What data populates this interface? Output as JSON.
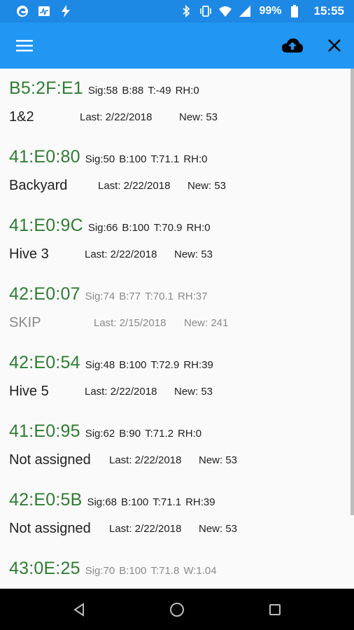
{
  "status_bar": {
    "left_icons": [
      "edge-browser-icon",
      "activity-monitor-icon",
      "flash-icon"
    ],
    "right_icons": [
      "bluetooth-icon",
      "vibrate-icon",
      "wifi-icon",
      "signal-icon",
      "battery-icon"
    ],
    "battery_percent": "99%",
    "time": "15:55"
  },
  "app_bar": {
    "menu_icon": "hamburger-menu-icon",
    "upload_icon": "cloud-upload-icon",
    "close_icon": "close-icon",
    "color": "#2196f3"
  },
  "colors": {
    "mac_green": "#2e7d32",
    "primary_text": "#212121",
    "dim_text": "#8a8a8a"
  },
  "devices": [
    {
      "mac": "B5:2F:E1",
      "sig": "Sig:58",
      "b": "B:88",
      "t": "T:-49",
      "extra": "RH:0",
      "name": "1&2",
      "last": "Last: 2/22/2018",
      "new": "New: 53",
      "dim": false
    },
    {
      "mac": "41:E0:80",
      "sig": "Sig:50",
      "b": "B:100",
      "t": "T:71.1",
      "extra": "RH:0",
      "name": "Backyard",
      "last": "Last: 2/22/2018",
      "new": "New: 53",
      "dim": false
    },
    {
      "mac": "41:E0:9C",
      "sig": "Sig:66",
      "b": "B:100",
      "t": "T:70.9",
      "extra": "RH:0",
      "name": "Hive 3",
      "last": "Last: 2/22/2018",
      "new": "New: 53",
      "dim": false
    },
    {
      "mac": "42:E0:07",
      "sig": "Sig:74",
      "b": "B:77",
      "t": "T:70.1",
      "extra": "RH:37",
      "name": "SKIP",
      "last": "Last: 2/15/2018",
      "new": "New: 241",
      "dim": true
    },
    {
      "mac": "42:E0:54",
      "sig": "Sig:48",
      "b": "B:100",
      "t": "T:72.9",
      "extra": "RH:39",
      "name": "Hive 5",
      "last": "Last: 2/22/2018",
      "new": "New: 53",
      "dim": false
    },
    {
      "mac": "41:E0:95",
      "sig": "Sig:62",
      "b": "B:90",
      "t": "T:71.2",
      "extra": "RH:0",
      "name": "Not assigned",
      "last": "Last: 2/22/2018",
      "new": "New: 53",
      "dim": false
    },
    {
      "mac": "42:E0:5B",
      "sig": "Sig:68",
      "b": "B:100",
      "t": "T:71.1",
      "extra": "RH:39",
      "name": "Not assigned",
      "last": "Last: 2/22/2018",
      "new": "New: 53",
      "dim": false
    },
    {
      "mac": "43:0E:25",
      "sig": "Sig:70",
      "b": "B:100",
      "t": "T:71.8",
      "extra": "W:1.04",
      "name": "",
      "last": "",
      "new": "",
      "dim": true
    }
  ],
  "nav_bar": {
    "back_icon": "back-triangle-icon",
    "home_icon": "home-circle-icon",
    "recents_icon": "recents-square-icon"
  }
}
